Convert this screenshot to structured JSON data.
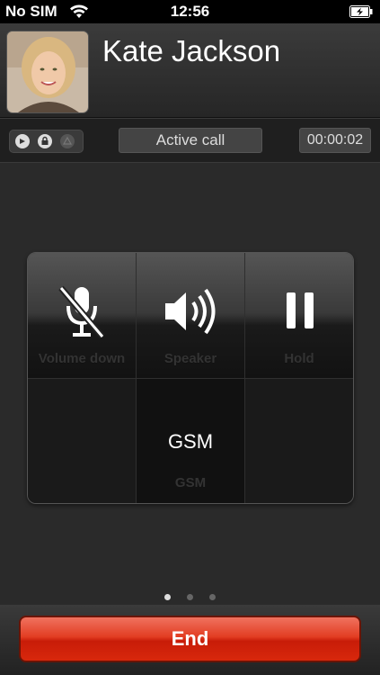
{
  "status_bar": {
    "carrier": "No SIM",
    "time": "12:56",
    "wifi_icon": "wifi-icon",
    "battery_icon": "battery-charging-icon"
  },
  "contact": {
    "name": "Kate Jackson",
    "avatar_icon": "contact-photo"
  },
  "call_info": {
    "status": "Active call",
    "duration": "00:00:02",
    "indicator_icons": [
      "call-indicator-icon",
      "lock-icon",
      "alert-icon"
    ]
  },
  "controls": {
    "mute": {
      "label": "Volume down",
      "icon": "microphone-muted-icon"
    },
    "speaker": {
      "label": "Speaker",
      "icon": "speaker-icon"
    },
    "hold": {
      "label": "Hold",
      "icon": "pause-icon"
    },
    "gsm": {
      "title": "GSM",
      "label": "GSM"
    }
  },
  "pager": {
    "pages": 3,
    "active": 0
  },
  "end_button": {
    "label": "End",
    "color": "#e23d22"
  }
}
